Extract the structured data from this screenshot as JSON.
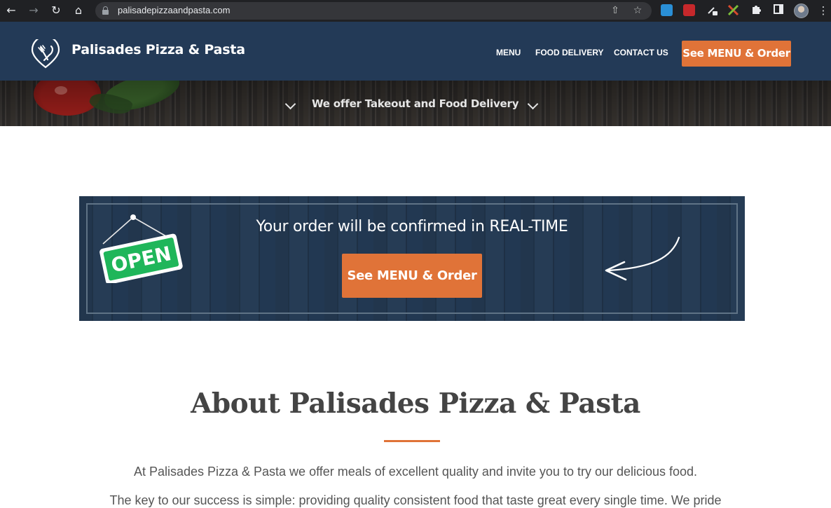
{
  "browser": {
    "url": "palisadepizzaandpasta.com",
    "icons": [
      "back-icon",
      "forward-icon",
      "reload-icon",
      "home-icon",
      "lock-icon",
      "share-icon",
      "star-icon",
      "extensions-icon",
      "side-panel-icon",
      "profile-avatar",
      "menu-icon"
    ]
  },
  "header": {
    "site_title": "Palisades Pizza & Pasta",
    "nav": {
      "menu": "MENU",
      "food_delivery": "FOOD DELIVERY",
      "contact_us": "CONTACT US"
    },
    "cta": "See MENU & Order"
  },
  "hero": {
    "tagline": "We offer Takeout and Food Delivery"
  },
  "banner": {
    "title": "Your order will be confirmed in REAL-TIME",
    "sign_text": "OPEN",
    "cta": "See MENU & Order"
  },
  "about": {
    "title": "About Palisades Pizza & Pasta",
    "paragraph1": "At Palisades Pizza & Pasta we offer meals of excellent quality and invite you to try our delicious food.",
    "paragraph2": "The key to our success is simple: providing quality consistent food that taste great every single time. We pride"
  },
  "colors": {
    "header_bg": "#233a57",
    "accent": "#e07338",
    "open_sign": "#1fb65a"
  }
}
